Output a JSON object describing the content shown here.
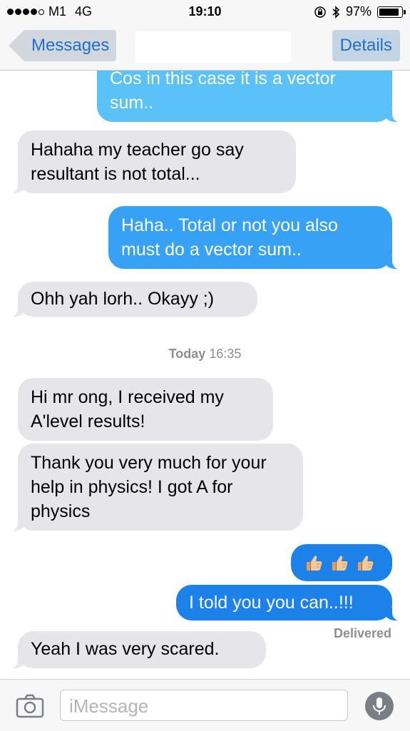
{
  "status_bar": {
    "carrier": "M1",
    "network": "4G",
    "time": "19:10",
    "battery": "97%",
    "battery_level": 0.97,
    "signal_bars": 4
  },
  "nav": {
    "back_label": "Messages",
    "details_label": "Details"
  },
  "messages": [
    {
      "direction": "outgoing",
      "text": "Cos in this case it is a vector sum.."
    },
    {
      "direction": "incoming",
      "text": "Hahaha my teacher go say resultant is not total..."
    },
    {
      "direction": "outgoing",
      "text": "Haha.. Total or not you also must do a vector sum.."
    },
    {
      "direction": "incoming",
      "text": "Ohh yah lorh.. Okayy ;)"
    },
    {
      "direction": "incoming",
      "text": "Hi mr ong, I received my A'level results!"
    },
    {
      "direction": "incoming",
      "text": "Thank you very much for your help in physics! I got A for physics"
    },
    {
      "direction": "outgoing",
      "text": "👍👍👍"
    },
    {
      "direction": "outgoing",
      "text": "I told you you can..!!!"
    },
    {
      "direction": "incoming",
      "text": "Yeah I was very scared."
    }
  ],
  "timestamp": {
    "day": "Today",
    "time": "16:35"
  },
  "delivered_label": "Delivered",
  "input": {
    "placeholder": "iMessage"
  },
  "icons": {
    "camera": "camera-icon",
    "mic": "microphone-icon",
    "back": "chevron-left-icon",
    "bluetooth": "bluetooth-icon",
    "rotation_lock": "rotation-lock-icon",
    "thumbs_up": "thumbs-up-icon"
  },
  "colors": {
    "incoming_bubble": "#e5e5ea",
    "outgoing_bubble": "#37a2f5",
    "link_blue": "#1f6fd1"
  }
}
